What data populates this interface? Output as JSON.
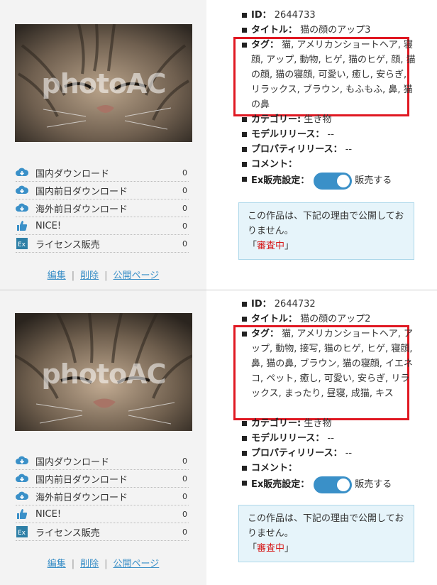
{
  "items": [
    {
      "id_label": "ID：",
      "id": "2644733",
      "title_label": "タイトル：",
      "title": "猫の顔のアップ3",
      "tags_label": "タグ：",
      "tags": "猫, アメリカンショートヘア, 寝顔, アップ, 動物, ヒゲ, 猫のヒゲ, 顔, 猫の顔, 猫の寝顔, 可愛い, 癒し, 安らぎ, リラックス, ブラウン, もふもふ, 鼻, 猫の鼻",
      "category_label": "カテゴリー:",
      "category": "生き物",
      "model_label": "モデルリリース：",
      "model": "--",
      "property_label": "プロパティリリース：",
      "property": "--",
      "comment_label": "コメント：",
      "comment": "",
      "ex_label": "Ex販売設定：",
      "ex_state": "販売する",
      "notice_text": "この作品は、下記の理由で公開しておりません。",
      "notice_open": "「",
      "notice_reason": "審査中",
      "notice_close": "」",
      "watermark": "photoAC",
      "stats": [
        {
          "label": "国内ダウンロード",
          "value": "0",
          "icon": "cloud-download-icon"
        },
        {
          "label": "国内前日ダウンロード",
          "value": "0",
          "icon": "cloud-download-icon"
        },
        {
          "label": "海外前日ダウンロード",
          "value": "0",
          "icon": "cloud-download-icon"
        },
        {
          "label": "NICE!",
          "value": "0",
          "icon": "thumbs-up-icon"
        },
        {
          "label": "ライセンス販売",
          "value": "0",
          "icon": "ex-icon"
        }
      ],
      "links": {
        "edit": "編集",
        "delete": "削除",
        "public": "公開ページ",
        "sep": "|"
      }
    },
    {
      "id_label": "ID：",
      "id": "2644732",
      "title_label": "タイトル：",
      "title": "猫の顔のアップ2",
      "tags_label": "タグ：",
      "tags": "猫, アメリカンショートヘア, アップ, 動物, 接写, 猫のヒゲ, ヒゲ, 寝顔, 鼻, 猫の鼻, ブラウン, 猫の寝顔, イエネコ, ペット, 癒し, 可愛い, 安らぎ, リラックス, まったり, 昼寝, 成猫, キス",
      "category_label": "カテゴリー:",
      "category": "生き物",
      "model_label": "モデルリリース：",
      "model": "--",
      "property_label": "プロパティリリース：",
      "property": "--",
      "comment_label": "コメント：",
      "comment": "",
      "ex_label": "Ex販売設定：",
      "ex_state": "販売する",
      "notice_text": "この作品は、下記の理由で公開しておりません。",
      "notice_open": "「",
      "notice_reason": "審査中",
      "notice_close": "」",
      "watermark": "photoAC",
      "stats": [
        {
          "label": "国内ダウンロード",
          "value": "0",
          "icon": "cloud-download-icon"
        },
        {
          "label": "国内前日ダウンロード",
          "value": "0",
          "icon": "cloud-download-icon"
        },
        {
          "label": "海外前日ダウンロード",
          "value": "0",
          "icon": "cloud-download-icon"
        },
        {
          "label": "NICE!",
          "value": "0",
          "icon": "thumbs-up-icon"
        },
        {
          "label": "ライセンス販売",
          "value": "0",
          "icon": "ex-icon"
        }
      ],
      "links": {
        "edit": "編集",
        "delete": "削除",
        "public": "公開ページ",
        "sep": "|"
      }
    }
  ],
  "colors": {
    "accent": "#3a90c8",
    "highlight_border": "#e01822",
    "notice_bg": "#e6f4fa",
    "review_red": "#d61a1a"
  }
}
